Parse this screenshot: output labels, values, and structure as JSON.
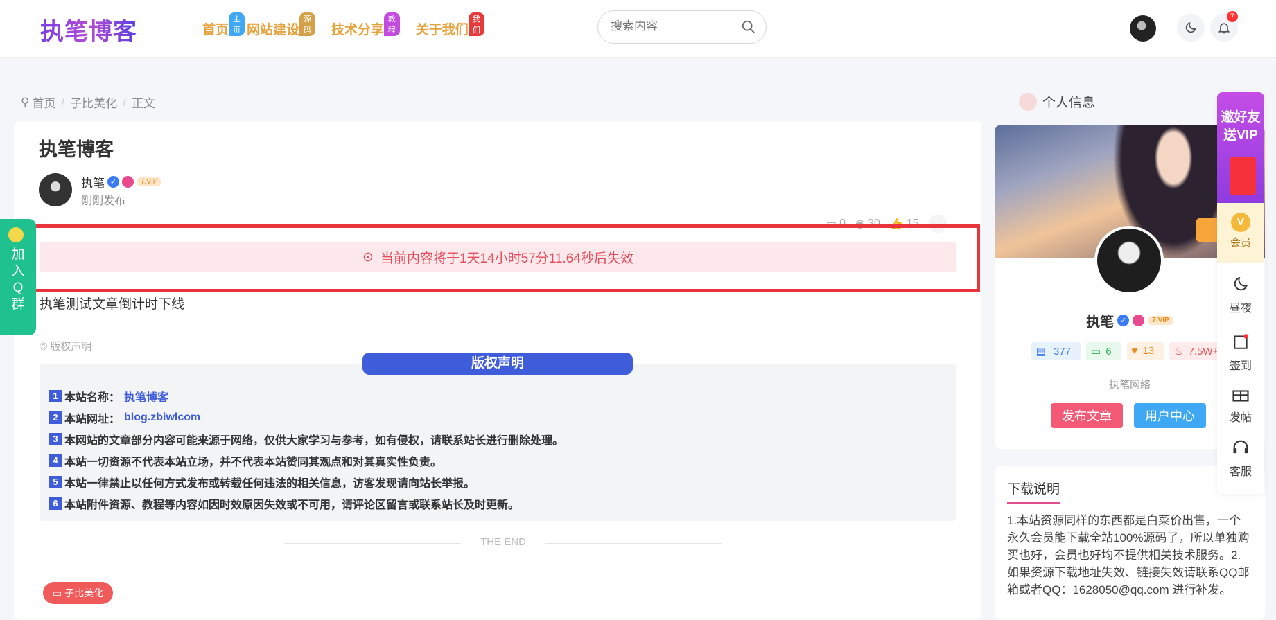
{
  "header": {
    "logo": "执笔博客",
    "nav": [
      {
        "label": "首页",
        "badge": "主页"
      },
      {
        "label": "网站建设",
        "badge": "源码"
      },
      {
        "label": "技术分享",
        "badge": "教程"
      },
      {
        "label": "关于我们",
        "badge": "我们"
      }
    ],
    "search_placeholder": "搜索内容",
    "notification_count": "7"
  },
  "breadcrumb": [
    "首页",
    "子比美化",
    "正文"
  ],
  "post": {
    "title": "执笔博客",
    "author": "执笔",
    "vip_label": "7.VIP",
    "time": "刚刚发布",
    "stats": {
      "comments": "0",
      "views": "30",
      "likes": "15"
    },
    "countdown": "当前内容将于1天14小时57分11.64秒后失效",
    "body": "执笔测试文章倒计时下线",
    "copyright_label": "© 版权声明",
    "copyright_title": "版权声明",
    "copyright_items": [
      {
        "num": "1",
        "text": "本站名称：",
        "value": "执笔博客"
      },
      {
        "num": "2",
        "text": "本站网址：",
        "value": "blog.zbiwlcom"
      },
      {
        "num": "3",
        "text": "本网站的文章部分内容可能来源于网络，仅供大家学习与参考，如有侵权，请联系站长进行删除处理。",
        "value": ""
      },
      {
        "num": "4",
        "text": "本站一切资源不代表本站立场，并不代表本站赞同其观点和对其真实性负责。",
        "value": ""
      },
      {
        "num": "5",
        "text": "本站一律禁止以任何方式发布或转载任何违法的相关信息，访客发现请向站长举报。",
        "value": ""
      },
      {
        "num": "6",
        "text": "本站附件资源、教程等内容如因时效原因失效或不可用，请评论区留言或联系站长及时更新。",
        "value": ""
      }
    ],
    "the_end": "THE END",
    "category": "子比美化"
  },
  "qq_float": {
    "line1": "加",
    "line2": "入",
    "line3": "Q",
    "line4": "群"
  },
  "sidebar": {
    "title": "个人信息",
    "name": "执笔",
    "vip_label": "7.VIP",
    "stats": {
      "posts": "377",
      "comments": "6",
      "favorites": "13",
      "hot": "7.5W+"
    },
    "org": "执笔网络",
    "btn_post": "发布文章",
    "btn_user": "用户中心",
    "download_title": "下载说明",
    "download_text": "1.本站资源同样的东西都是白菜价出售，一个永久会员能下载全站100%源码了，所以单独购买也好，会员也好均不提供相关技术服务。2.如果资源下载地址失效、链接失效请联系QQ邮箱或者QQ：1628050@qq.com 进行补发。"
  },
  "right_float": {
    "invite_line1": "邀好友",
    "invite_line2": "送VIP",
    "vip": "会员",
    "daynight": "昼夜",
    "checkin": "签到",
    "publish": "发帖",
    "service": "客服"
  }
}
